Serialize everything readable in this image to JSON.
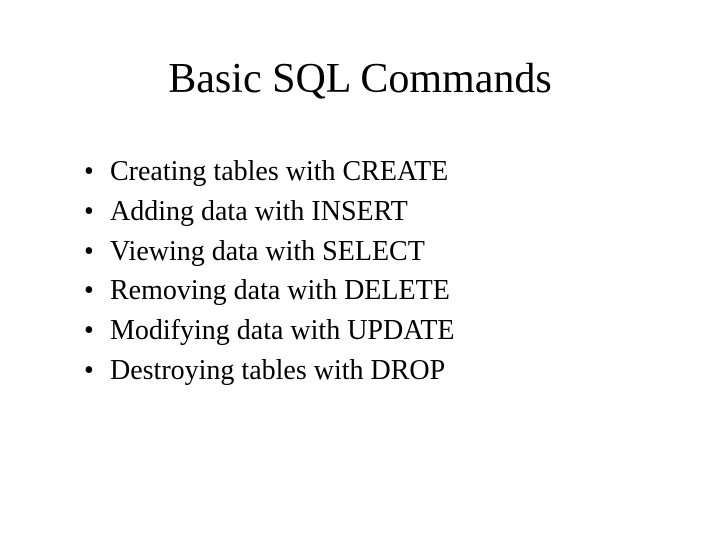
{
  "slide": {
    "title": "Basic SQL Commands",
    "bullets": [
      "Creating tables with CREATE",
      "Adding data with INSERT",
      "Viewing data with SELECT",
      "Removing data with DELETE",
      "Modifying data with UPDATE",
      "Destroying tables with DROP"
    ]
  }
}
